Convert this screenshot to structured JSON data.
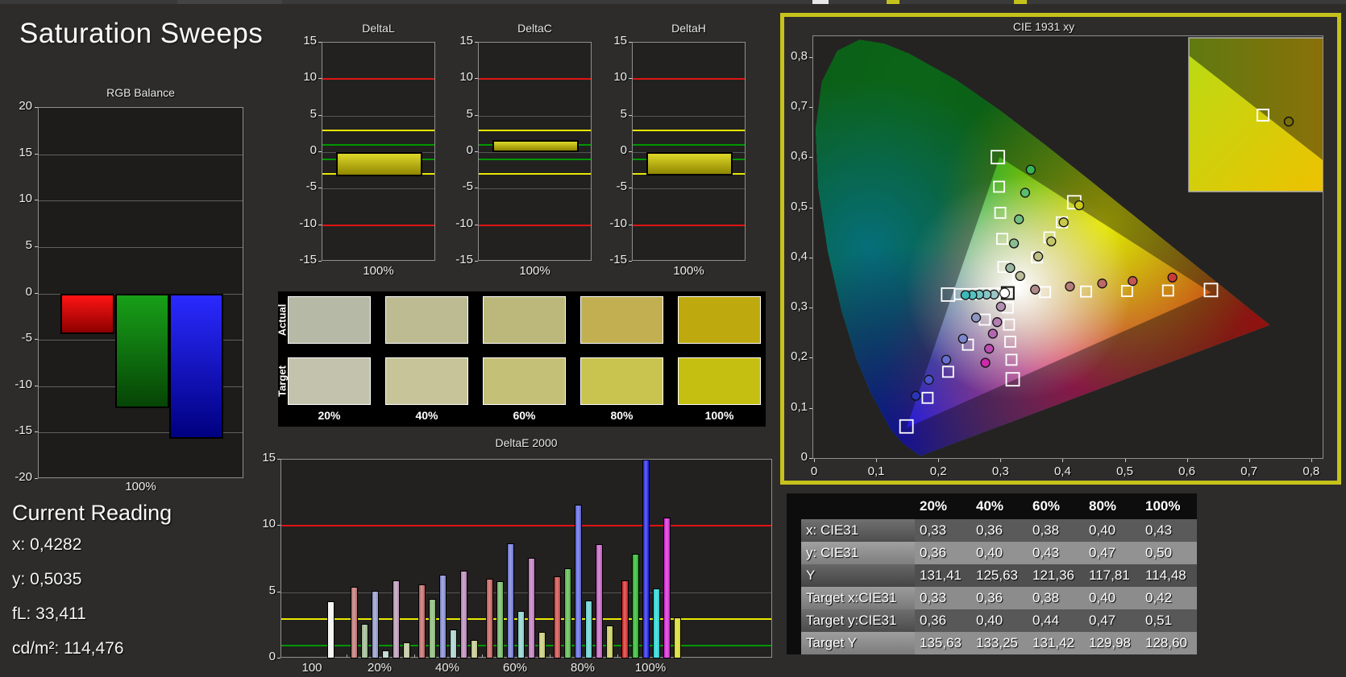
{
  "app": {
    "title": "Saturation Sweeps"
  },
  "current_reading": {
    "heading": "Current Reading",
    "values": [
      "x: 0,4282",
      "y: 0,5035",
      "fL: 33,411",
      "cd/m²: 114,476"
    ]
  },
  "colors": {
    "background": "#2d2c2b",
    "chart_bg": "#222120",
    "panel_border": "#8f8f8f",
    "grid": "#565656",
    "selection_frame": "#c6c21c",
    "limit_red": "#e01414",
    "limit_yellow": "#e8e800",
    "limit_green": "#009600",
    "text": "#f2f2f2"
  },
  "swatches": {
    "row_labels": [
      "Actual",
      "Target"
    ],
    "col_labels": [
      "20%",
      "40%",
      "60%",
      "80%",
      "100%"
    ],
    "actual_colors": [
      "#b5b9a5",
      "#bcbb92",
      "#bcb87b",
      "#c2af52",
      "#bea90f"
    ],
    "target_colors": [
      "#c3c2ac",
      "#c6c498",
      "#c5c077",
      "#c9c350",
      "#c5bf11"
    ]
  },
  "chart_data": [
    {
      "id": "rgb_balance",
      "type": "bar",
      "title": "RGB Balance",
      "xlabel": "100%",
      "ylim": [
        -20,
        20
      ],
      "ytick_step": 5,
      "grid": true,
      "series": [
        {
          "name": "Red",
          "value": -4.4,
          "color_top": "#ff1414",
          "color_bottom": "#8c0000"
        },
        {
          "name": "Green",
          "value": -12.4,
          "color_top": "#18a018",
          "color_bottom": "#064406"
        },
        {
          "name": "Blue",
          "value": -15.7,
          "color_top": "#2a2aff",
          "color_bottom": "#000080"
        }
      ]
    },
    {
      "id": "deltaL",
      "type": "bar",
      "title": "DeltaL",
      "xlabel": "100%",
      "ylim": [
        -15,
        15
      ],
      "ytick_step": 5,
      "value": -3.3,
      "limits": {
        "red": 10,
        "yellow": 3,
        "green": 1
      },
      "bar_color_top": "#ded82a",
      "bar_color_bottom": "#8f8600"
    },
    {
      "id": "deltaC",
      "type": "bar",
      "title": "DeltaC",
      "xlabel": "100%",
      "ylim": [
        -15,
        15
      ],
      "ytick_step": 5,
      "value": 1.7,
      "limits": {
        "red": 10,
        "yellow": 3,
        "green": 1
      },
      "bar_color_top": "#ded82a",
      "bar_color_bottom": "#8f8600"
    },
    {
      "id": "deltaH",
      "type": "bar",
      "title": "DeltaH",
      "xlabel": "100%",
      "ylim": [
        -15,
        15
      ],
      "ytick_step": 5,
      "value": -3.2,
      "limits": {
        "red": 10,
        "yellow": 3,
        "green": 1
      },
      "bar_color_top": "#ded82a",
      "bar_color_bottom": "#8f8600"
    },
    {
      "id": "deltaE2000",
      "type": "bar",
      "title": "DeltaE 2000",
      "ylim": [
        0,
        15
      ],
      "yticks": [
        0,
        5,
        10,
        15
      ],
      "limits": {
        "red": 10,
        "yellow": 3,
        "green": 1
      },
      "groups": [
        {
          "label": "100",
          "bars": [
            {
              "name": "white",
              "value": 4.3,
              "color": "#f2f2f2"
            }
          ]
        },
        {
          "label": "20%",
          "bars": [
            {
              "name": "red",
              "value": 5.4,
              "color": "#b56d6b"
            },
            {
              "name": "green",
              "value": 2.6,
              "color": "#97b289"
            },
            {
              "name": "blue",
              "value": 5.1,
              "color": "#8a92c2"
            },
            {
              "name": "cyan",
              "value": 0.6,
              "color": "#b7cfca"
            },
            {
              "name": "magenta",
              "value": 5.9,
              "color": "#b391b0"
            },
            {
              "name": "yellow",
              "value": 1.2,
              "color": "#bdc09a"
            }
          ]
        },
        {
          "label": "40%",
          "bars": [
            {
              "name": "red",
              "value": 5.6,
              "color": "#b95f5c"
            },
            {
              "name": "green",
              "value": 4.5,
              "color": "#83b171"
            },
            {
              "name": "blue",
              "value": 6.3,
              "color": "#7a82c8"
            },
            {
              "name": "cyan",
              "value": 2.2,
              "color": "#a3cdc6"
            },
            {
              "name": "magenta",
              "value": 6.6,
              "color": "#b382b1"
            },
            {
              "name": "yellow",
              "value": 1.4,
              "color": "#bfc188"
            }
          ]
        },
        {
          "label": "60%",
          "bars": [
            {
              "name": "red",
              "value": 6.0,
              "color": "#c05350"
            },
            {
              "name": "green",
              "value": 5.8,
              "color": "#6bb25a"
            },
            {
              "name": "blue",
              "value": 8.7,
              "color": "#6a71cf"
            },
            {
              "name": "cyan",
              "value": 3.6,
              "color": "#83cdcb"
            },
            {
              "name": "magenta",
              "value": 7.6,
              "color": "#ba71b7"
            },
            {
              "name": "yellow",
              "value": 2.0,
              "color": "#c3c46e"
            }
          ]
        },
        {
          "label": "80%",
          "bars": [
            {
              "name": "red",
              "value": 6.2,
              "color": "#c63f3b"
            },
            {
              "name": "green",
              "value": 6.8,
              "color": "#4fb23d"
            },
            {
              "name": "blue",
              "value": 11.6,
              "color": "#555fd5"
            },
            {
              "name": "cyan",
              "value": 4.4,
              "color": "#60cccb"
            },
            {
              "name": "magenta",
              "value": 8.6,
              "color": "#c058bd"
            },
            {
              "name": "yellow",
              "value": 2.5,
              "color": "#c7c854"
            }
          ]
        },
        {
          "label": "100%",
          "bars": [
            {
              "name": "red",
              "value": 5.9,
              "color": "#d31d1d"
            },
            {
              "name": "green",
              "value": 7.9,
              "color": "#1bb31b"
            },
            {
              "name": "blue",
              "value": 15.0,
              "color": "#1a1ade"
            },
            {
              "name": "cyan",
              "value": 5.3,
              "color": "#1ecfcf"
            },
            {
              "name": "magenta",
              "value": 10.6,
              "color": "#cf1dcf"
            },
            {
              "name": "yellow",
              "value": 3.1,
              "color": "#d6d61d"
            }
          ]
        }
      ]
    },
    {
      "id": "cie",
      "type": "scatter",
      "title": "CIE 1931 xy",
      "xlim": [
        0,
        0.82
      ],
      "ylim": [
        0,
        0.843
      ],
      "xtick_labels": [
        "0",
        "0,1",
        "0,2",
        "0,3",
        "0,4",
        "0,5",
        "0,6",
        "0,7",
        "0,8"
      ],
      "ytick_labels": [
        "0",
        "0,1",
        "0,2",
        "0,3",
        "0,4",
        "0,5",
        "0,6",
        "0,7",
        "0,8"
      ],
      "gamut_triangle": [
        [
          0.64,
          0.33
        ],
        [
          0.3,
          0.6
        ],
        [
          0.15,
          0.06
        ]
      ],
      "white_point": {
        "target": [
          0.313,
          0.329
        ],
        "measured": [
          0.308,
          0.329
        ]
      },
      "sweeps": [
        {
          "name": "red",
          "targets": [
            [
              0.373,
              0.331
            ],
            [
              0.439,
              0.332
            ],
            [
              0.505,
              0.333
            ],
            [
              0.571,
              0.334
            ],
            [
              0.64,
              0.335
            ]
          ],
          "measured": [
            [
              0.357,
              0.336
            ],
            [
              0.413,
              0.342
            ],
            [
              0.465,
              0.348
            ],
            [
              0.514,
              0.353
            ],
            [
              0.578,
              0.36
            ]
          ],
          "point_colors": [
            "#b18a8a",
            "#b67d7b",
            "#bd6967",
            "#c55551",
            "#cd3a36"
          ]
        },
        {
          "name": "green",
          "targets": [
            [
              0.306,
              0.381
            ],
            [
              0.304,
              0.437
            ],
            [
              0.301,
              0.489
            ],
            [
              0.299,
              0.541
            ],
            [
              0.297,
              0.6
            ]
          ],
          "measured": [
            [
              0.317,
              0.379
            ],
            [
              0.323,
              0.428
            ],
            [
              0.331,
              0.476
            ],
            [
              0.341,
              0.529
            ],
            [
              0.35,
              0.575
            ]
          ],
          "point_colors": [
            "#9bb6a1",
            "#8bbd92",
            "#72bd81",
            "#58bd6f",
            "#35b455"
          ]
        },
        {
          "name": "blue",
          "targets": [
            [
              0.276,
              0.276
            ],
            [
              0.249,
              0.226
            ],
            [
              0.217,
              0.172
            ],
            [
              0.184,
              0.12
            ],
            [
              0.15,
              0.063
            ]
          ],
          "measured": [
            [
              0.262,
              0.28
            ],
            [
              0.241,
              0.238
            ],
            [
              0.214,
              0.196
            ],
            [
              0.186,
              0.156
            ],
            [
              0.165,
              0.124
            ]
          ],
          "point_colors": [
            "#8d95c1",
            "#7b84cc",
            "#666fd0",
            "#4b55cf",
            "#2a34b8"
          ]
        },
        {
          "name": "cyan",
          "targets": [
            [
              0.293,
              0.328
            ],
            [
              0.274,
              0.328
            ],
            [
              0.255,
              0.327
            ],
            [
              0.236,
              0.327
            ],
            [
              0.217,
              0.326
            ]
          ],
          "measured": [
            [
              0.291,
              0.326
            ],
            [
              0.279,
              0.326
            ],
            [
              0.267,
              0.326
            ],
            [
              0.256,
              0.325
            ],
            [
              0.245,
              0.325
            ]
          ],
          "point_colors": [
            "#9dc5c5",
            "#88c5c4",
            "#70c5c3",
            "#55c1c0",
            "#3bb9b8"
          ]
        },
        {
          "name": "magenta",
          "targets": [
            [
              0.313,
              0.3
            ],
            [
              0.315,
              0.266
            ],
            [
              0.317,
              0.232
            ],
            [
              0.319,
              0.196
            ],
            [
              0.321,
              0.157
            ]
          ],
          "measured": [
            [
              0.302,
              0.302
            ],
            [
              0.296,
              0.271
            ],
            [
              0.289,
              0.248
            ],
            [
              0.283,
              0.218
            ],
            [
              0.277,
              0.19
            ]
          ],
          "point_colors": [
            "#b28fb2",
            "#b37eb3",
            "#b566b1",
            "#bd4db2",
            "#cd29aa"
          ]
        },
        {
          "name": "yellow",
          "targets": [
            [
              0.33,
              0.36
            ],
            [
              0.36,
              0.4
            ],
            [
              0.38,
              0.44
            ],
            [
              0.4,
              0.47
            ],
            [
              0.42,
              0.51
            ]
          ],
          "measured": [
            [
              0.333,
              0.363
            ],
            [
              0.362,
              0.402
            ],
            [
              0.383,
              0.432
            ],
            [
              0.403,
              0.47
            ],
            [
              0.428,
              0.504
            ]
          ],
          "point_colors": [
            "#bcbc9c",
            "#c0c083",
            "#c4c46a",
            "#c8c84e",
            "#cbc81f"
          ]
        }
      ],
      "inset": {
        "bright_color1": "#b8dc14",
        "bright_color2": "#f0c000",
        "dark_color1": "#5f7a10",
        "dark_color2": "#8f6f08",
        "marker_fill": "#7a6e0a"
      }
    },
    {
      "id": "table",
      "type": "table",
      "columns": [
        "20%",
        "40%",
        "60%",
        "80%",
        "100%"
      ],
      "rows": [
        {
          "label": "x: CIE31",
          "values": [
            "0,33",
            "0,36",
            "0,38",
            "0,40",
            "0,43"
          ]
        },
        {
          "label": "y: CIE31",
          "values": [
            "0,36",
            "0,40",
            "0,43",
            "0,47",
            "0,50"
          ]
        },
        {
          "label": "Y",
          "values": [
            "131,41",
            "125,63",
            "121,36",
            "117,81",
            "114,48"
          ]
        },
        {
          "label": "Target x:CIE31",
          "values": [
            "0,33",
            "0,36",
            "0,38",
            "0,40",
            "0,42"
          ]
        },
        {
          "label": "Target y:CIE31",
          "values": [
            "0,36",
            "0,40",
            "0,44",
            "0,47",
            "0,51"
          ]
        },
        {
          "label": "Target Y",
          "values": [
            "135,63",
            "133,25",
            "131,42",
            "129,98",
            "128,60"
          ]
        }
      ],
      "row_bgs": [
        "#5a5a5a",
        "#929292",
        "#4f4f4f",
        "#8c8c8c",
        "#585858",
        "#8f8f8f"
      ]
    }
  ]
}
